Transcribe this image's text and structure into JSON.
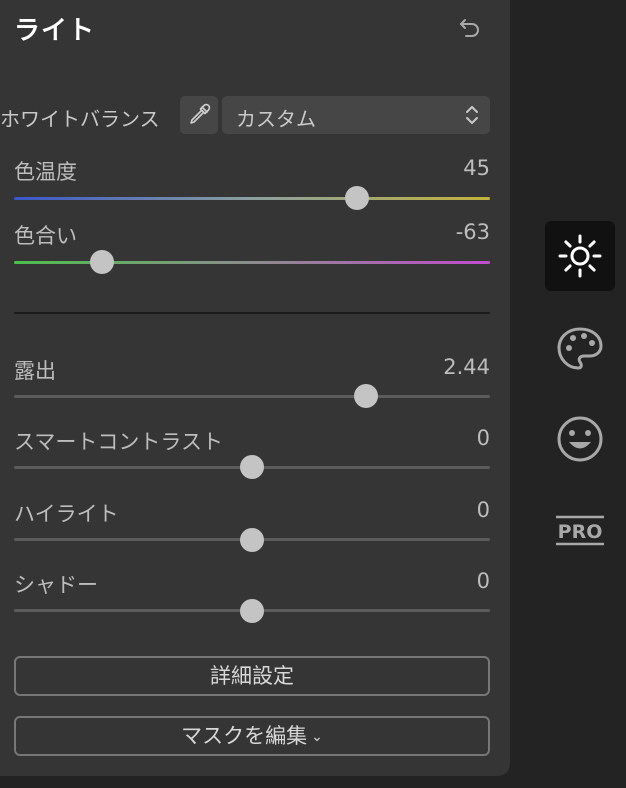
{
  "panel": {
    "title": "ライト",
    "undo_icon": "undo-icon"
  },
  "white_balance": {
    "label": "ホワイトバランス",
    "eyedropper_icon": "eyedropper-icon",
    "selected": "カスタム"
  },
  "sliders": {
    "temperature": {
      "label": "色温度",
      "value": "45",
      "position": 0.72
    },
    "tint": {
      "label": "色合い",
      "value": "-63",
      "position": 0.185
    },
    "exposure": {
      "label": "露出",
      "value": "2.44",
      "position": 0.74
    },
    "smart_contrast": {
      "label": "スマートコントラスト",
      "value": "0",
      "position": 0.5
    },
    "highlights": {
      "label": "ハイライト",
      "value": "0",
      "position": 0.5
    },
    "shadows": {
      "label": "シャドー",
      "value": "0",
      "position": 0.5
    }
  },
  "buttons": {
    "advanced": "詳細設定",
    "mask": "マスクを編集",
    "mask_chevron": "⌄"
  },
  "side_toolbar": {
    "items": [
      {
        "icon": "sun-icon",
        "active": true
      },
      {
        "icon": "palette-icon",
        "active": false
      },
      {
        "icon": "smiley-icon",
        "active": false
      },
      {
        "icon": "pro-icon",
        "label": "PRO",
        "active": false
      }
    ]
  },
  "colors": {
    "panel_bg": "#353535",
    "app_bg": "#232323",
    "thumb": "#c4c4c4"
  }
}
